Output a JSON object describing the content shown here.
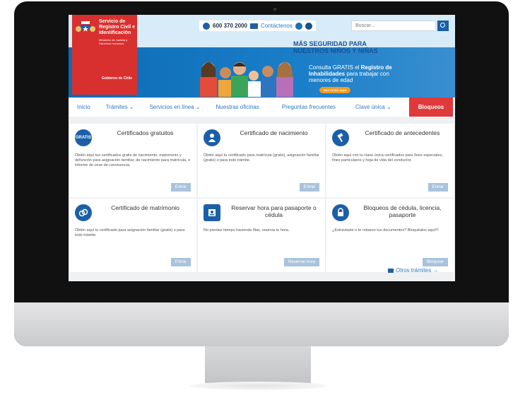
{
  "brand": {
    "line1": "Servicio de Registro Civil e Identificación",
    "line2": "Ministerio de Justicia y Derechos Humanos",
    "gob": "Gobierno de Chile"
  },
  "topbar": {
    "phone": "600 370 2000",
    "contact": "Contáctenos"
  },
  "search": {
    "placeholder": "Buscar..."
  },
  "banner": {
    "headline": "MÁS SEGURIDAD PARA NUESTROS NIÑOS Y NIÑAS",
    "line_a": "Consulta GRATIS el ",
    "line_b": "Registro de Inhabilidades",
    "line_c": " para trabajar con menores de edad",
    "cta": "HAZ CLICK AQUÍ"
  },
  "nav": {
    "items": [
      "Inicio",
      "Trámites ⌄",
      "Servicios en línea ⌄",
      "Nuestras oficinas",
      "Preguntas frecuentes",
      "Clave única ⌄"
    ],
    "bloqueos": "Bloqueos"
  },
  "cards": [
    {
      "icon": "gratis-icon",
      "icon_text": "GRATIS",
      "title": "Certificados gratuitos",
      "desc": "Obtén aquí tus certificados gratis de nacimiento, matrimonio y defunción para asignación familiar, de nacimiento para matrícula, e informe de cese de convivencia.",
      "button": "Entrar"
    },
    {
      "icon": "baby-icon",
      "icon_text": "",
      "title": "Certificado de nacimiento",
      "desc": "Obtén aquí tu certificado para matrícula (gratis), asignación familiar (gratis) o para todo trámite.",
      "button": "Entrar"
    },
    {
      "icon": "gavel-icon",
      "icon_text": "",
      "title": "Certificado de antecedentes",
      "desc": "Obtén aquí con tu clave única certificados para fines especiales, fines particulares y hoja de vida del conductor.",
      "button": "Entrar"
    },
    {
      "icon": "rings-icon",
      "icon_text": "",
      "title": "Certificado de matrimonio",
      "desc": "Obtén aquí tu certificado para asignación familiar (gratis) o para todo trámite.",
      "button": "Entrar"
    },
    {
      "icon": "passport-icon",
      "icon_text": "",
      "title": "Reservar hora para pasaporte o cédula",
      "desc": "No pierdas tiempo haciendo filas, reserva tu hora.",
      "button": "Reservar hora"
    },
    {
      "icon": "lock-icon",
      "icon_text": "",
      "title": "Bloqueos de cédula, licencia, pasaporte",
      "desc": "¿Extraviaste o te robaron tus documentos? Bloquéalos aquí!!!",
      "button": "Bloquear"
    }
  ],
  "more": "Otros trámites →"
}
